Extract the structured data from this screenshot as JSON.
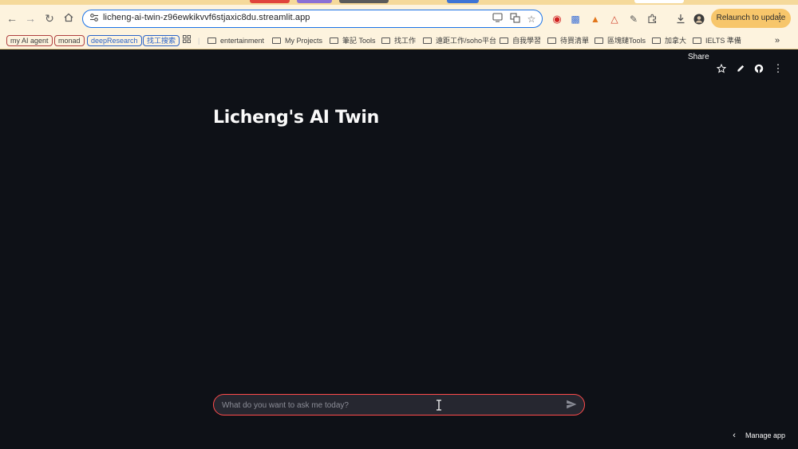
{
  "browser": {
    "url": "licheng-ai-twin-z96ewkikvvf6stjaxic8du.streamlit.app",
    "relaunch_label": "Relaunch to update",
    "bookmarks": [
      {
        "label": "my AI agent",
        "type": "chip",
        "color": "#b04040"
      },
      {
        "label": "monad",
        "type": "chip",
        "color": "#b04040"
      },
      {
        "label": "deepResearch",
        "type": "chip",
        "color": "#2a63c9"
      },
      {
        "label": "找工搜索",
        "type": "chip",
        "color": "#2a63c9"
      },
      {
        "label": "entertainment",
        "type": "folder"
      },
      {
        "label": "My Projects",
        "type": "folder"
      },
      {
        "label": "筆記 Tools",
        "type": "folder"
      },
      {
        "label": "找工作",
        "type": "folder"
      },
      {
        "label": "遠距工作/soho平台",
        "type": "folder"
      },
      {
        "label": "自我學習",
        "type": "folder"
      },
      {
        "label": "待買清單",
        "type": "folder"
      },
      {
        "label": "區塊鏈Tools",
        "type": "folder"
      },
      {
        "label": "加拿大",
        "type": "folder"
      },
      {
        "label": "IELTS 準備",
        "type": "folder"
      }
    ],
    "more_bookmarks": "»"
  },
  "app": {
    "header": {
      "share_label": "Share"
    },
    "title": "Licheng's AI Twin",
    "chat_input": {
      "placeholder": "What do you want to ask me today?",
      "value": ""
    },
    "manage_label": "Manage app"
  },
  "colors": {
    "background": "#0e1117",
    "input_border": "#ff4b4b",
    "input_bg": "#262730",
    "chrome_bg": "#fdf3de",
    "relaunch_bg": "#f7c66b"
  }
}
